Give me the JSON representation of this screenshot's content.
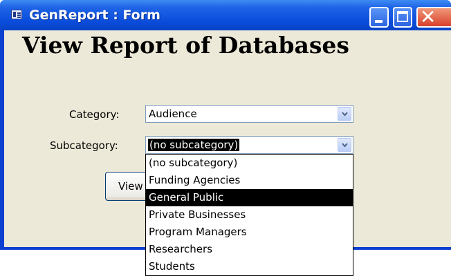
{
  "window": {
    "title": "GenReport : Form",
    "icon": "form-icon",
    "controls": [
      "minimize-icon",
      "maximize-icon",
      "close-icon"
    ],
    "colors": {
      "titlebar": "#0a4ddc",
      "client": "#ece9d8",
      "close": "#d8402a"
    }
  },
  "form": {
    "heading": "View Report of Databases",
    "category": {
      "label": "Category:",
      "value": "Audience"
    },
    "subcategory": {
      "label": "Subcategory:",
      "value": "(no subcategory)",
      "options": [
        "(no subcategory)",
        "Funding Agencies",
        "General Public",
        "Private Businesses",
        "Program Managers",
        "Researchers",
        "Students"
      ],
      "highlighted_index": 2
    },
    "view_button": {
      "label": "View"
    }
  }
}
